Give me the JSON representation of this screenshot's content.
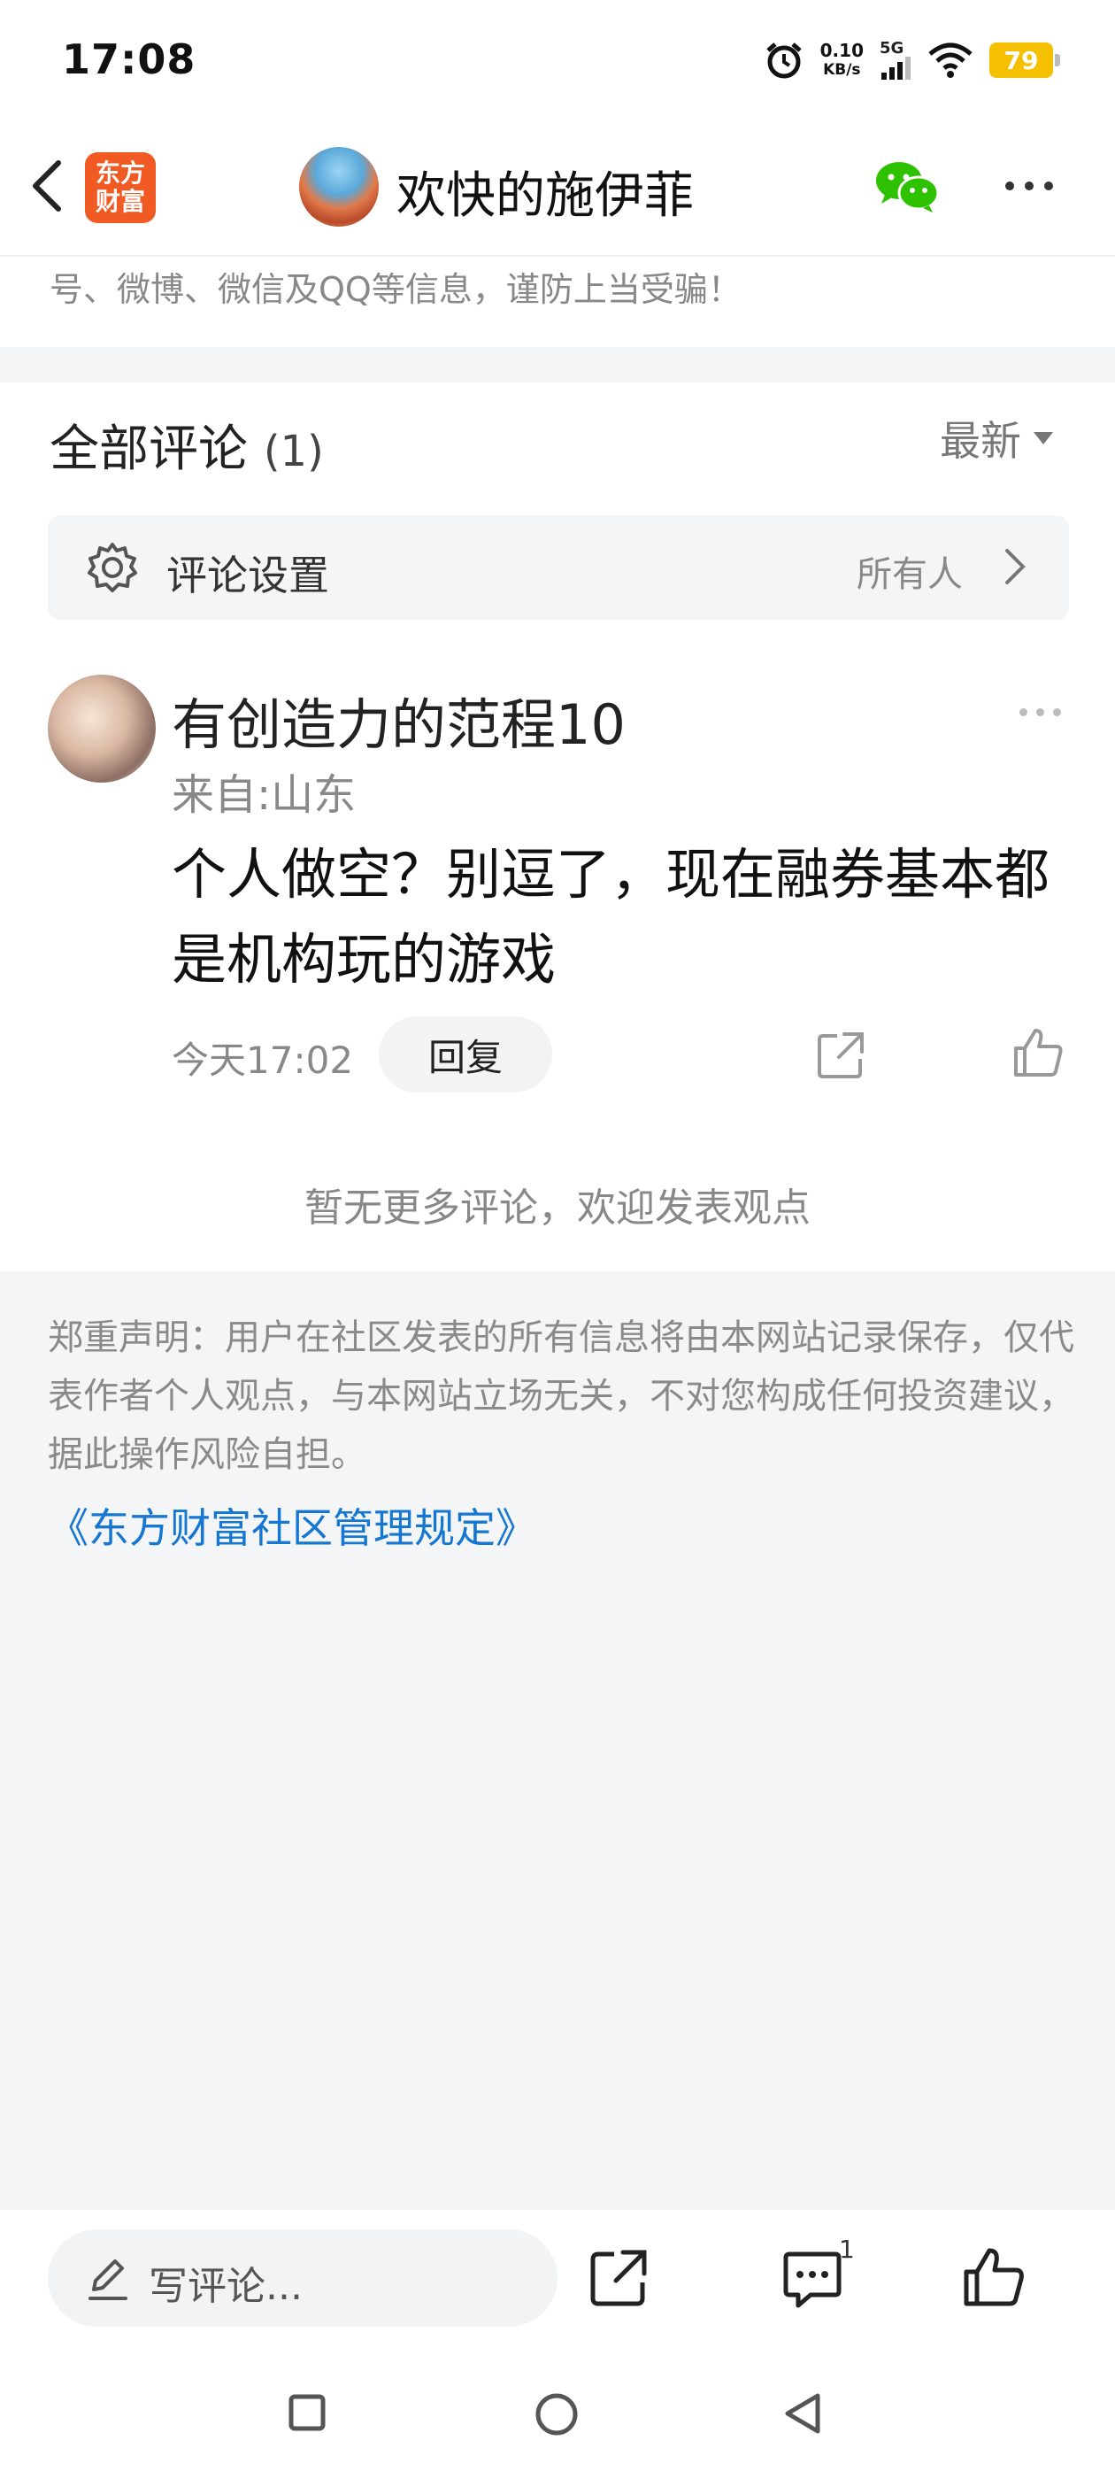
{
  "status_bar": {
    "time": "17:08",
    "net_speed_value": "0.10",
    "net_speed_unit": "KB/s",
    "signal_label": "5G",
    "battery": "79",
    "icons": [
      "alarm-icon",
      "signal-icon",
      "wifi-icon",
      "battery-icon"
    ]
  },
  "header": {
    "logo_line1": "东方",
    "logo_line2": "财富",
    "user_name": "欢快的施伊菲",
    "icons": [
      "back-icon",
      "wechat-icon",
      "more-icon"
    ]
  },
  "notice": "号、微博、微信及QQ等信息，谨防上当受骗！",
  "comments": {
    "title": "全部评论",
    "count": "(1)",
    "sort_label": "最新",
    "settings_label": "评论设置",
    "settings_value": "所有人",
    "items": [
      {
        "author": "有创造力的范程10",
        "location": "来自:山东",
        "text": "个人做空？别逗了，现在融券基本都是机构玩的游戏",
        "time": "今天17:02",
        "reply_label": "回复"
      }
    ],
    "no_more": "暂无更多评论，欢迎发表观点"
  },
  "disclaimer": {
    "text": "郑重声明：用户在社区发表的所有信息将由本网站记录保存，仅代表作者个人观点，与本网站立场无关，不对您构成任何投资建议，据此操作风险自担。",
    "link": "《东方财富社区管理规定》"
  },
  "bottom_bar": {
    "input_placeholder": "写评论...",
    "comment_count": "1"
  },
  "colors": {
    "accent_orange": "#f15a22",
    "link_blue": "#1677d2",
    "battery_yellow": "#f5c000",
    "wechat_green": "#2dc100"
  }
}
